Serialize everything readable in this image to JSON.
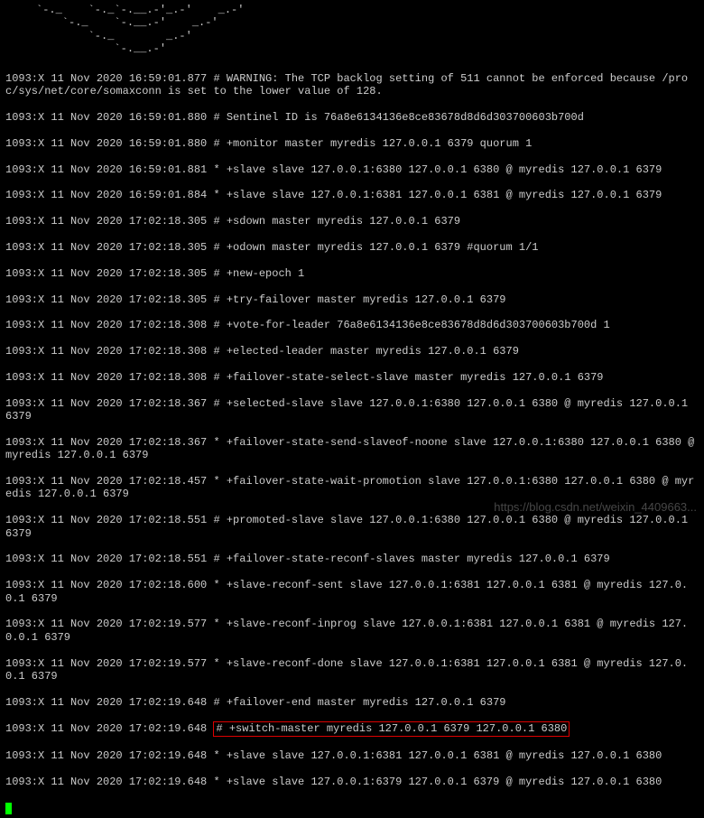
{
  "ascii_art": "`-._    `-._`-.__.-'_.-'    _.-'\n    `-._    `-.__.-'    _.-'\n        `-._        _.-'\n            `-.__.-'",
  "warning": "1093:X 11 Nov 2020 16:59:01.877 # WARNING: The TCP backlog setting of 511 cannot be enforced because /proc/sys/net/core/somaxconn is set to the lower value of 128.",
  "lines": [
    "1093:X 11 Nov 2020 16:59:01.880 # Sentinel ID is 76a8e6134136e8ce83678d8d6d303700603b700d",
    "1093:X 11 Nov 2020 16:59:01.880 # +monitor master myredis 127.0.0.1 6379 quorum 1",
    "1093:X 11 Nov 2020 16:59:01.881 * +slave slave 127.0.0.1:6380 127.0.0.1 6380 @ myredis 127.0.0.1 6379",
    "1093:X 11 Nov 2020 16:59:01.884 * +slave slave 127.0.0.1:6381 127.0.0.1 6381 @ myredis 127.0.0.1 6379",
    "1093:X 11 Nov 2020 17:02:18.305 # +sdown master myredis 127.0.0.1 6379",
    "1093:X 11 Nov 2020 17:02:18.305 # +odown master myredis 127.0.0.1 6379 #quorum 1/1",
    "1093:X 11 Nov 2020 17:02:18.305 # +new-epoch 1",
    "1093:X 11 Nov 2020 17:02:18.305 # +try-failover master myredis 127.0.0.1 6379",
    "1093:X 11 Nov 2020 17:02:18.308 # +vote-for-leader 76a8e6134136e8ce83678d8d6d303700603b700d 1",
    "1093:X 11 Nov 2020 17:02:18.308 # +elected-leader master myredis 127.0.0.1 6379",
    "1093:X 11 Nov 2020 17:02:18.308 # +failover-state-select-slave master myredis 127.0.0.1 6379",
    "1093:X 11 Nov 2020 17:02:18.367 # +selected-slave slave 127.0.0.1:6380 127.0.0.1 6380 @ myredis 127.0.0.1 6379",
    "1093:X 11 Nov 2020 17:02:18.367 * +failover-state-send-slaveof-noone slave 127.0.0.1:6380 127.0.0.1 6380 @ myredis 127.0.0.1 6379",
    "1093:X 11 Nov 2020 17:02:18.457 * +failover-state-wait-promotion slave 127.0.0.1:6380 127.0.0.1 6380 @ myredis 127.0.0.1 6379",
    "1093:X 11 Nov 2020 17:02:18.551 # +promoted-slave slave 127.0.0.1:6380 127.0.0.1 6380 @ myredis 127.0.0.1 6379",
    "1093:X 11 Nov 2020 17:02:18.551 # +failover-state-reconf-slaves master myredis 127.0.0.1 6379",
    "1093:X 11 Nov 2020 17:02:18.600 * +slave-reconf-sent slave 127.0.0.1:6381 127.0.0.1 6381 @ myredis 127.0.0.1 6379",
    "1093:X 11 Nov 2020 17:02:19.577 * +slave-reconf-inprog slave 127.0.0.1:6381 127.0.0.1 6381 @ myredis 127.0.0.1 6379",
    "1093:X 11 Nov 2020 17:02:19.577 * +slave-reconf-done slave 127.0.0.1:6381 127.0.0.1 6381 @ myredis 127.0.0.1 6379",
    "1093:X 11 Nov 2020 17:02:19.648 # +failover-end master myredis 127.0.0.1 6379"
  ],
  "highlighted_prefix": "1093:X 11 Nov 2020 17:02:19.648 ",
  "highlighted_text": "# +switch-master myredis 127.0.0.1 6379 127.0.0.1 6380",
  "tail": [
    "1093:X 11 Nov 2020 17:02:19.648 * +slave slave 127.0.0.1:6381 127.0.0.1 6381 @ myredis 127.0.0.1 6380",
    "1093:X 11 Nov 2020 17:02:19.648 * +slave slave 127.0.0.1:6379 127.0.0.1 6379 @ myredis 127.0.0.1 6380"
  ],
  "watermark": "https://blog.csdn.net/weixin_4409663..."
}
